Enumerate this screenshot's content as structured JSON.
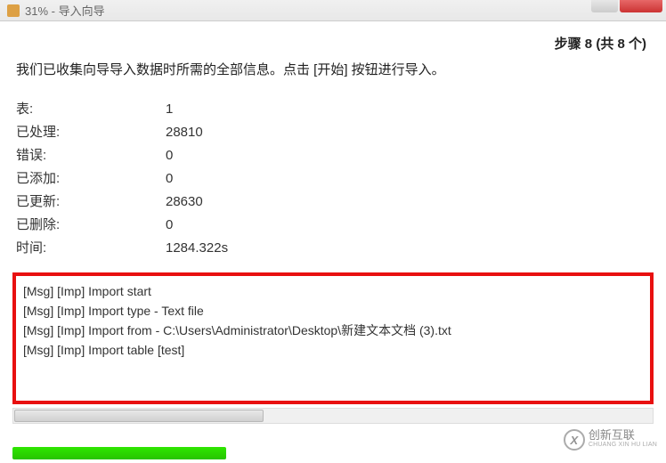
{
  "titlebar": {
    "text": "31% - 导入向导"
  },
  "header": {
    "step_text": "步骤 8 (共 8 个)"
  },
  "description": "我们已收集向导导入数据时所需的全部信息。点击 [开始] 按钮进行导入。",
  "stats": {
    "rows": [
      {
        "label": "表:",
        "value": "1"
      },
      {
        "label": "已处理:",
        "value": "28810"
      },
      {
        "label": "错误:",
        "value": "0"
      },
      {
        "label": "已添加:",
        "value": "0"
      },
      {
        "label": "已更新:",
        "value": "28630"
      },
      {
        "label": "已删除:",
        "value": "0"
      },
      {
        "label": "时间:",
        "value": "1284.322s"
      }
    ]
  },
  "log": {
    "lines": [
      "[Msg] [Imp] Import start",
      "[Msg] [Imp] Import type - Text file",
      "[Msg] [Imp] Import from - C:\\Users\\Administrator\\Desktop\\新建文本文档 (3).txt",
      "[Msg] [Imp] Import table [test]"
    ]
  },
  "watermark": {
    "icon_letter": "X",
    "cn": "创新互联",
    "en": "CHUANG XIN HU LIAN"
  }
}
